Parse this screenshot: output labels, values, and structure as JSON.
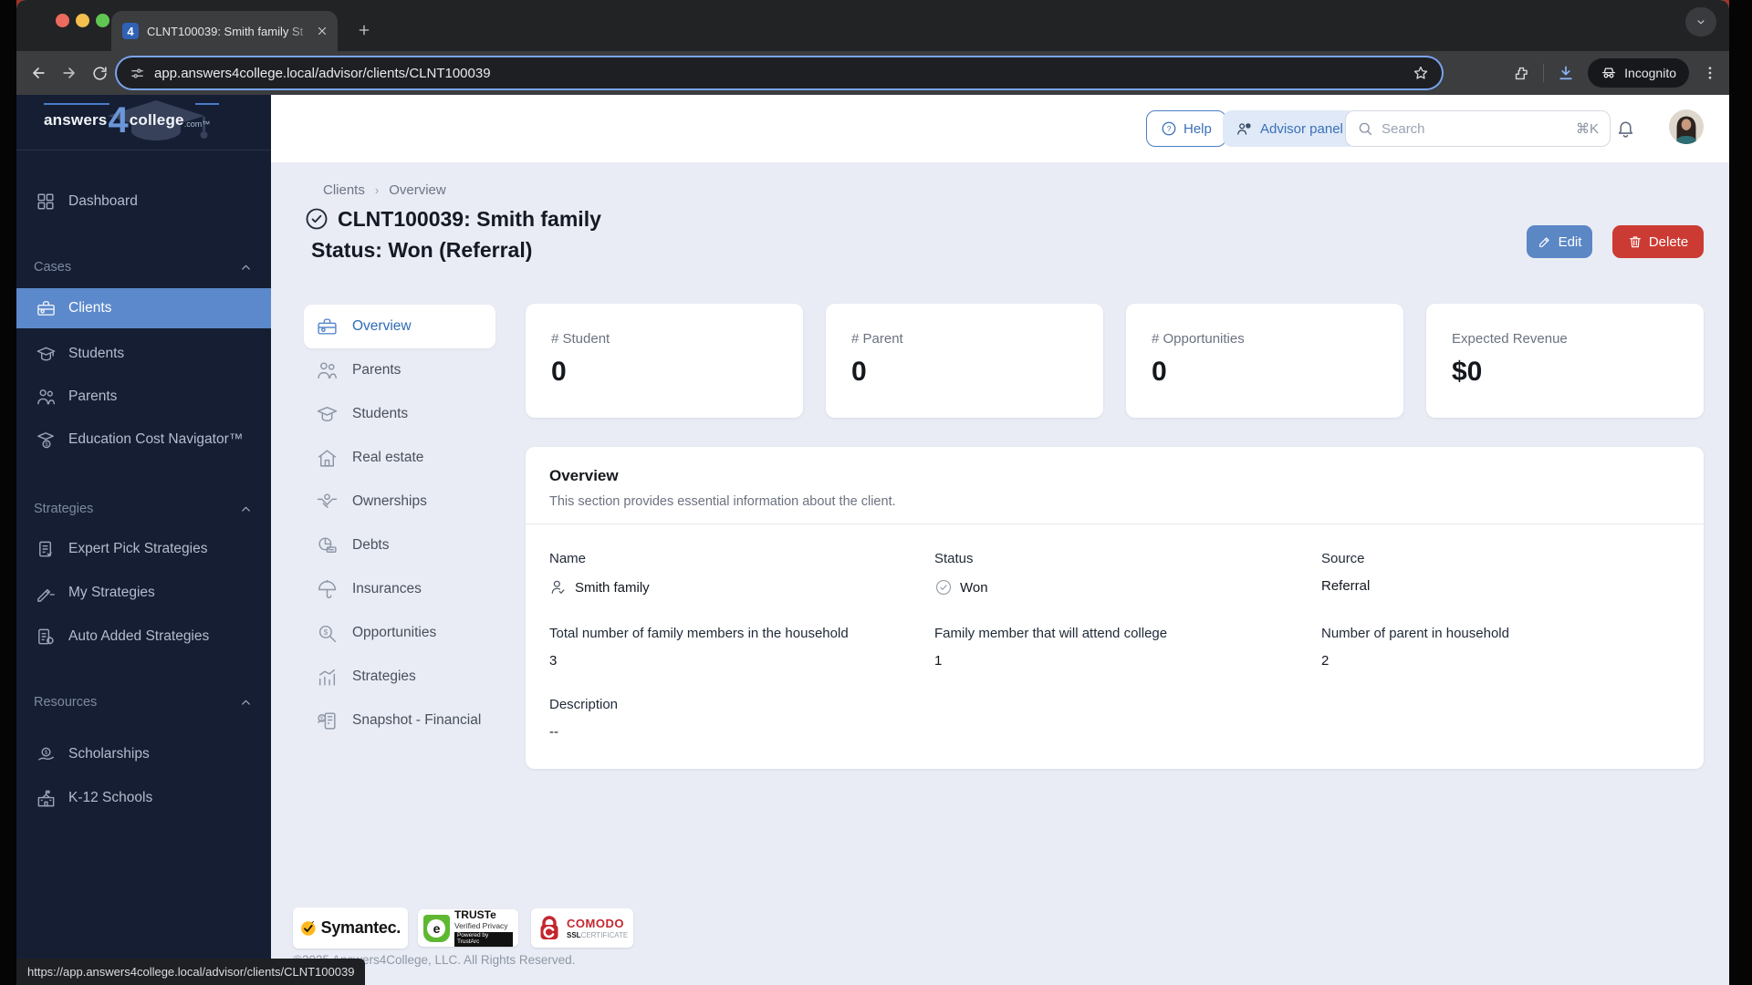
{
  "browser": {
    "tab_title": "CLNT100039: Smith family St",
    "url": "app.answers4college.local/advisor/clients/CLNT100039",
    "incognito_label": "Incognito",
    "status_url": "https://app.answers4college.local/advisor/clients/CLNT100039",
    "favicon_glyph": "4"
  },
  "topbar": {
    "help_label": "Help",
    "advisor_panel_label": "Advisor panel",
    "search_placeholder": "Search",
    "search_shortcut": "⌘K"
  },
  "logo": {
    "part1": "answers",
    "part2": "4",
    "part3": "college",
    "part4": ".com™"
  },
  "sidebar": {
    "dashboard": "Dashboard",
    "sections": [
      {
        "label": "Cases",
        "items": [
          "Clients",
          "Students",
          "Parents",
          "Education Cost Navigator™"
        ]
      },
      {
        "label": "Strategies",
        "items": [
          "Expert Pick Strategies",
          "My Strategies",
          "Auto Added Strategies"
        ]
      },
      {
        "label": "Resources",
        "items": [
          "Scholarships",
          "K-12 Schools"
        ]
      }
    ],
    "selected_item": "Clients"
  },
  "breadcrumb": {
    "items": [
      "Clients",
      "Overview"
    ]
  },
  "page": {
    "title_line1": "CLNT100039: Smith family",
    "title_line2": "Status: Won (Referral)",
    "edit_label": "Edit",
    "delete_label": "Delete"
  },
  "subnav": {
    "selected": "Overview",
    "items": [
      "Overview",
      "Parents",
      "Students",
      "Real estate",
      "Ownerships",
      "Debts",
      "Insurances",
      "Opportunities",
      "Strategies",
      "Snapshot - Financial"
    ]
  },
  "stats": [
    {
      "label": "# Student",
      "value": "0"
    },
    {
      "label": "# Parent",
      "value": "0"
    },
    {
      "label": "# Opportunities",
      "value": "0"
    },
    {
      "label": "Expected Revenue",
      "value": "$0"
    }
  ],
  "overview_panel": {
    "title": "Overview",
    "subtitle": "This section provides essential information about the client.",
    "fields": [
      {
        "label": "Name",
        "value": "Smith family"
      },
      {
        "label": "Status",
        "value": "Won"
      },
      {
        "label": "Source",
        "value": "Referral"
      },
      {
        "label": "Total number of family members in the household",
        "value": "3"
      },
      {
        "label": "Family member that will attend college",
        "value": "1"
      },
      {
        "label": "Number of parent in household",
        "value": "2"
      },
      {
        "label": "Description",
        "value": "--"
      }
    ]
  },
  "footer": {
    "symantec_text": "Symantec.",
    "truste_line1": "TRUSTe",
    "truste_line2": "Verified Privacy",
    "truste_line3": "Powered by TrustArc",
    "comodo_line1": "COMODO",
    "comodo_ssl": "SSL",
    "comodo_cert": "CERTIFICATE",
    "copyright": "©2025 Answers4College, LLC. All Rights Reserved."
  },
  "colors": {
    "accent_blue": "#4a7bc8",
    "selected_blue": "#5c89cb",
    "delete_red": "#cc3b33",
    "sidebar_navy": "#151e33"
  }
}
